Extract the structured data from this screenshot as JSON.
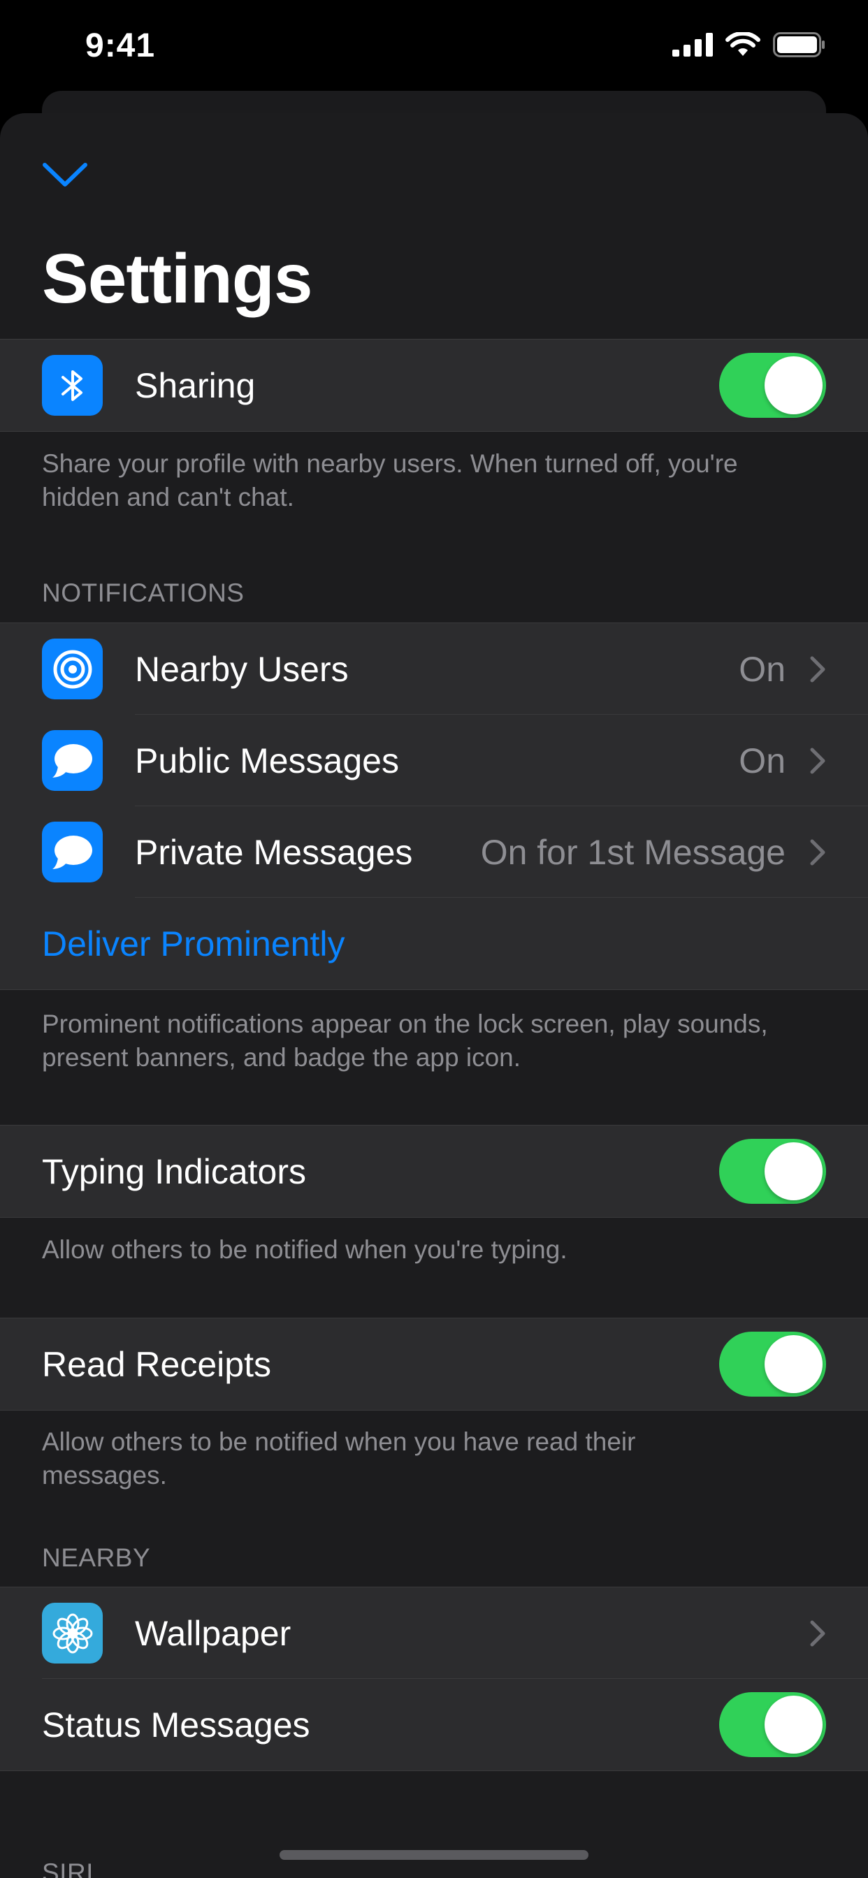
{
  "status_bar": {
    "time": "9:41"
  },
  "header": {
    "title": "Settings"
  },
  "sharing": {
    "label": "Sharing",
    "enabled": true,
    "footer": "Share your profile with nearby users. When turned off, you're hidden and can't chat."
  },
  "notifications": {
    "header": "NOTIFICATIONS",
    "items": [
      {
        "label": "Nearby Users",
        "value": "On"
      },
      {
        "label": "Public Messages",
        "value": "On"
      },
      {
        "label": "Private Messages",
        "value": "On for 1st Message"
      }
    ],
    "deliver_label": "Deliver Prominently",
    "footer": "Prominent notifications appear on the lock screen, play sounds, present banners, and badge the app icon."
  },
  "typing": {
    "label": "Typing Indicators",
    "enabled": true,
    "footer": "Allow others to be notified when you're typing."
  },
  "receipts": {
    "label": "Read Receipts",
    "enabled": true,
    "footer": "Allow others to be notified when you have read their messages."
  },
  "nearby": {
    "header": "NEARBY",
    "wallpaper_label": "Wallpaper",
    "status_label": "Status Messages",
    "status_enabled": true
  },
  "siri": {
    "header": "SIRI"
  },
  "colors": {
    "accent": "#0a84ff",
    "toggle_on": "#30d158",
    "background": "#1c1c1e",
    "cell": "#2c2c2e",
    "secondary_text": "#8e8e93"
  },
  "icons": {
    "sharing": "bluetooth-icon",
    "nearby_users": "target-icon",
    "public_messages": "speech-bubble-icon",
    "private_messages": "speech-bubble-icon",
    "wallpaper": "flower-icon"
  }
}
